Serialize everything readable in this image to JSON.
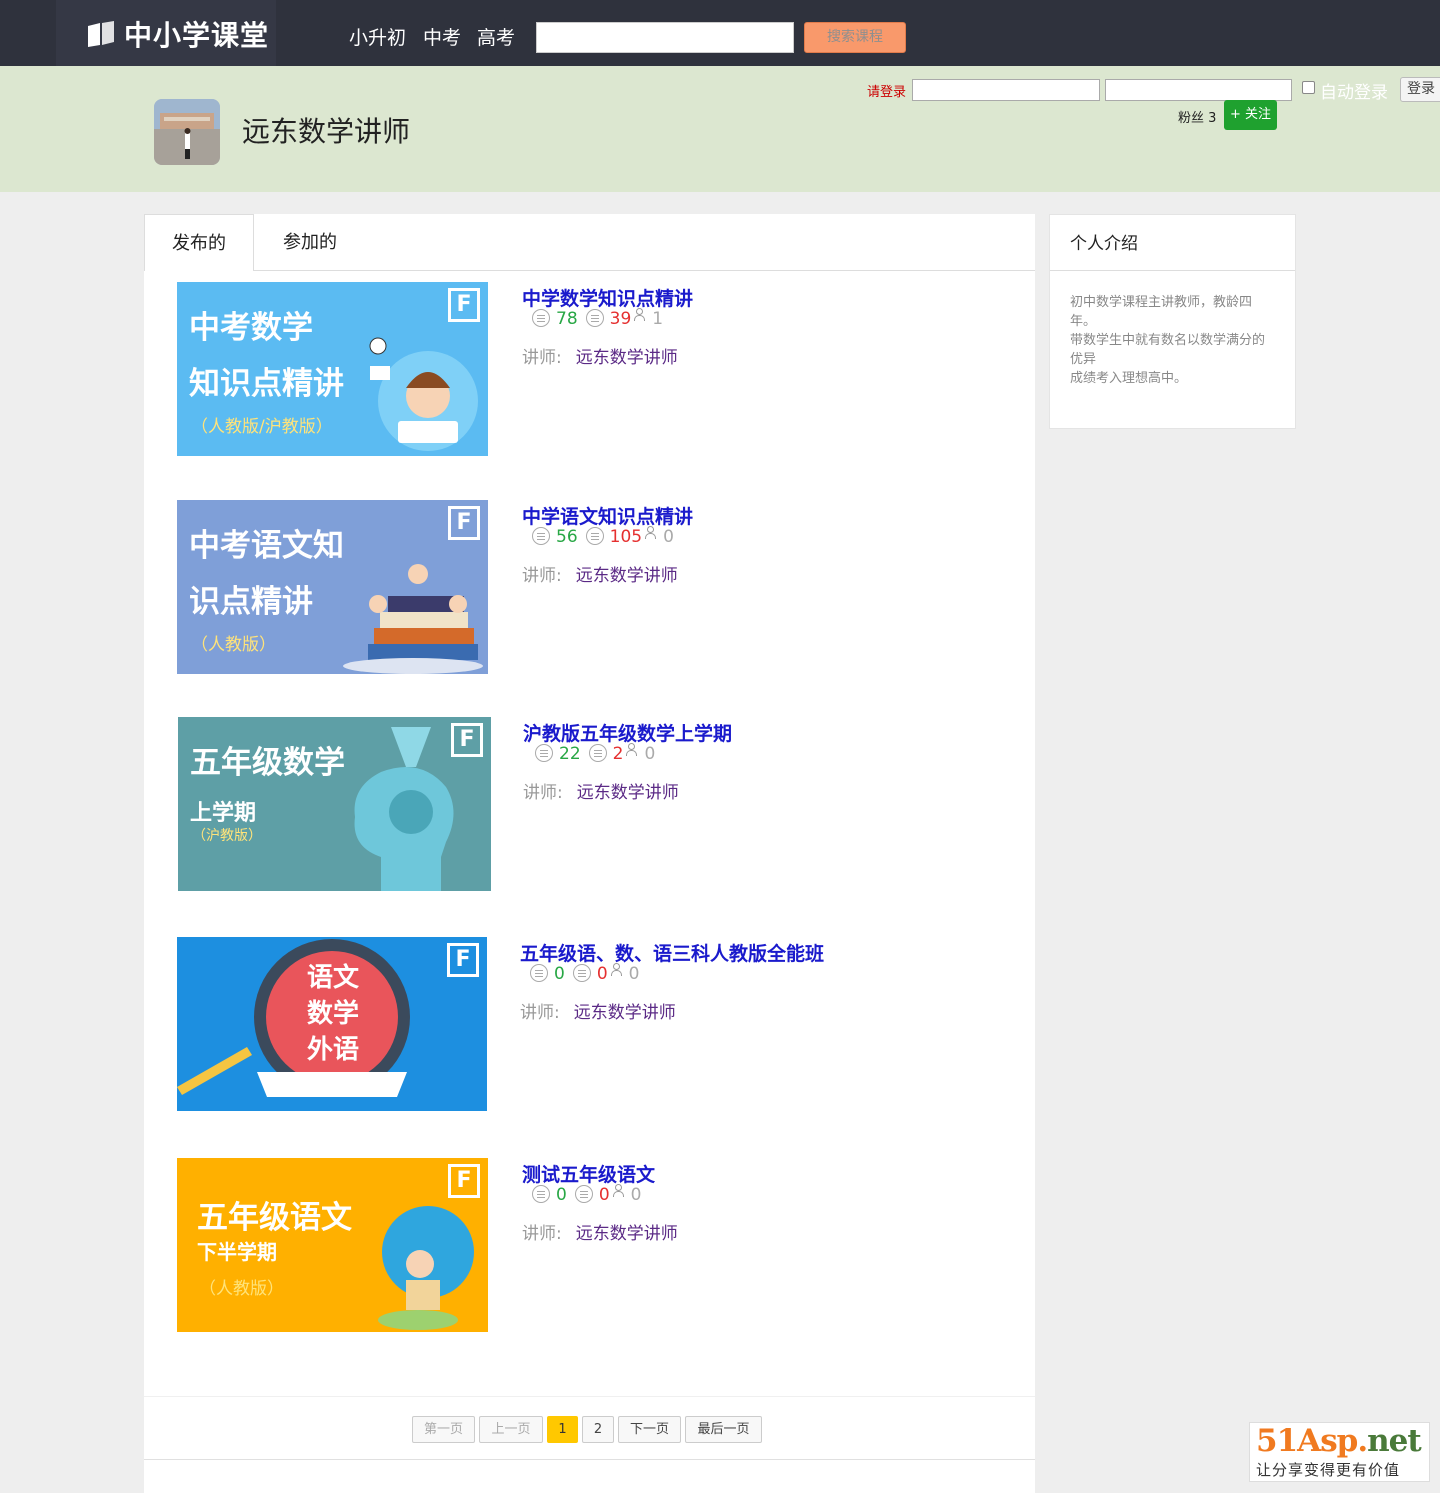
{
  "topbar": {
    "logo_text": "中小学课堂",
    "nav": [
      "小升初",
      "中考",
      "高考"
    ],
    "search_placeholder": "",
    "search_button": "搜索课程"
  },
  "profile": {
    "name": "远东数学讲师",
    "fans_label": "粉丝 3",
    "follow_button": "+ 关注"
  },
  "login": {
    "prompt": "请登录",
    "auto_login_label": "自动登录",
    "login_button": "登录"
  },
  "tabs": [
    "发布的",
    "参加的"
  ],
  "teacher_label": "讲师:",
  "courses": [
    {
      "title": "中学数学知识点精讲",
      "good": "78",
      "bad": "39",
      "students": "1",
      "teacher": "远东数学讲师",
      "thumb_line1": "中考数学",
      "thumb_line2": "知识点精讲",
      "thumb_line3": "（人教版/沪教版）",
      "thumb_bg": "#5bbbf2"
    },
    {
      "title": "中学语文知识点精讲",
      "good": "56",
      "bad": "105",
      "students": "0",
      "teacher": "远东数学讲师",
      "thumb_line1": "中考语文知",
      "thumb_line2": "识点精讲",
      "thumb_line3": "（人教版）",
      "thumb_bg": "#7f9fd8"
    },
    {
      "title": "沪教版五年级数学上学期",
      "good": "22",
      "bad": "2",
      "students": "0",
      "teacher": "远东数学讲师",
      "thumb_line1": "五年级数学",
      "thumb_line2": "上学期",
      "thumb_line3": "（沪教版）",
      "thumb_bg": "#5e9fa6"
    },
    {
      "title": "五年级语、数、语三科人教版全能班",
      "good": "0",
      "bad": "0",
      "students": "0",
      "teacher": "远东数学讲师",
      "thumb_line1": "语文",
      "thumb_line2": "数学",
      "thumb_line3": "外语",
      "thumb_bg": "#1d8fe0"
    },
    {
      "title": "测试五年级语文",
      "good": "0",
      "bad": "0",
      "students": "0",
      "teacher": "远东数学讲师",
      "thumb_line1": "五年级语文",
      "thumb_line2": "下半学期",
      "thumb_line3": "（人教版）",
      "thumb_bg": "#ffb000"
    }
  ],
  "pager": {
    "first": "第一页",
    "prev": "上一页",
    "pages": [
      "1",
      "2"
    ],
    "next": "下一页",
    "last": "最后一页"
  },
  "sidebar": {
    "title": "个人介绍",
    "lines": [
      "初中数学课程主讲教师，教龄四年。",
      "带数学生中就有数名以数学满分的优异",
      "成绩考入理想高中。"
    ]
  },
  "watermark": {
    "brand_a": "51Asp.",
    "brand_b": "net",
    "slogan": "让分享变得更有价值"
  },
  "colors": {
    "topbar": "#2f323d",
    "band": "#dce7d0",
    "course_title": "#1a1acc",
    "good": "#28a745",
    "bad": "#e53030",
    "follow": "#1fa12f",
    "active_page": "#ffc800"
  }
}
